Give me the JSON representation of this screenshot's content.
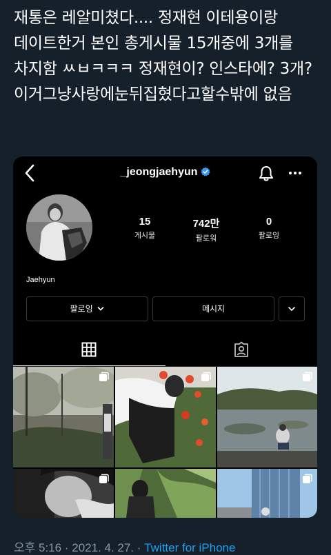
{
  "tweet": {
    "text": "재통은 레알미쳤다.... 정재현 이테용이랑 데이트한거 본인 총게시물 15개중에 3개를 차지함 ㅆㅂㅋㅋㅋ 정재현이? 인스타에? 3개? 이거그냥사랑에눈뒤집혔다고할수밖에 없음",
    "time": "오후 5:16",
    "separator1": "·",
    "date": "2021. 4. 27.",
    "separator2": "·",
    "source": "Twitter for iPhone"
  },
  "instagram": {
    "username": "_jeongjaehyun",
    "verified": true,
    "stats": [
      {
        "value": "15",
        "label": "게시물"
      },
      {
        "value": "742만",
        "label": "팔로워"
      },
      {
        "value": "0",
        "label": "팔로잉"
      }
    ],
    "name": "Jaehyun",
    "buttons": {
      "following": "팔로잉",
      "message": "메시지"
    },
    "icons": {
      "back": "chevron-left-icon",
      "verified": "verified-badge-icon",
      "bell": "bell-icon",
      "more": "more-icon",
      "grid": "grid-icon",
      "tagged": "tagged-icon",
      "multi": "multiple-photos-icon"
    },
    "accent": "#3897f0",
    "background": "#000000"
  },
  "colors": {
    "tweet_background": "#15202b",
    "meta_text": "#8899a6",
    "link": "#1da1f2"
  }
}
